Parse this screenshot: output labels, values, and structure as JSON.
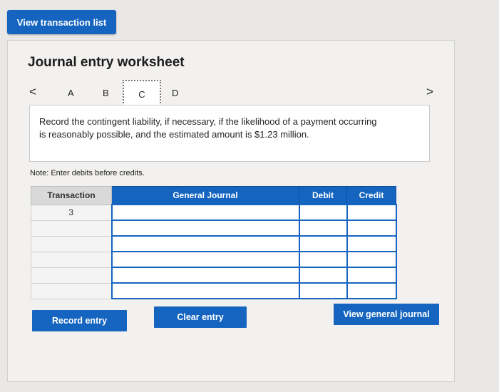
{
  "header": {
    "view_list_label": "View transaction list"
  },
  "worksheet": {
    "title": "Journal entry worksheet",
    "tabs": [
      "A",
      "B",
      "C",
      "D"
    ],
    "active_tab": "C",
    "instruction": "Record the contingent liability, if necessary, if the likelihood of a payment occurring is reasonably possible, and the estimated amount is $1.23 million.",
    "note": "Note: Enter debits before credits."
  },
  "table": {
    "columns": [
      "Transaction",
      "General Journal",
      "Debit",
      "Credit"
    ],
    "transaction_number": "3",
    "rows": 6
  },
  "buttons": {
    "record": "Record entry",
    "clear": "Clear entry",
    "view_journal": "View general journal"
  },
  "colors": {
    "accent": "#1565c0",
    "background": "#e9e8e6"
  }
}
